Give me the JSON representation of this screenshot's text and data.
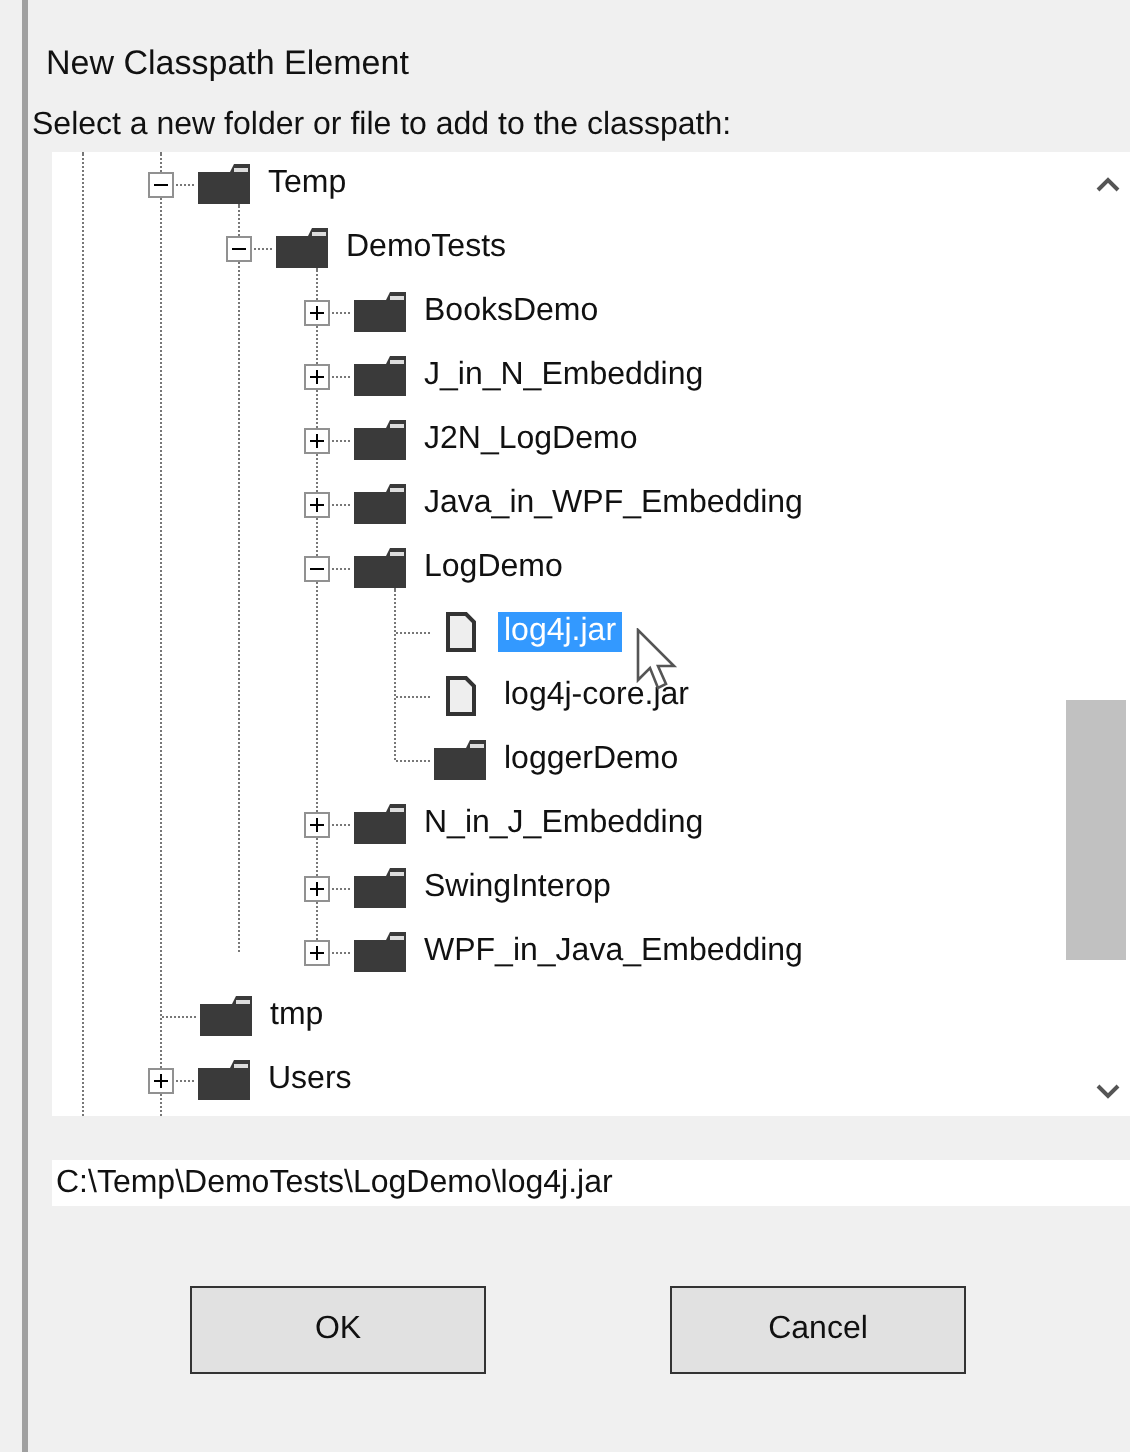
{
  "window": {
    "title": "New Classpath Element"
  },
  "prompt": "Select a new folder or file to add to the classpath:",
  "tree": [
    {
      "label": "Temp",
      "kind": "folder",
      "expanded": true,
      "selected": false,
      "children": [
        {
          "label": "DemoTests",
          "kind": "folder",
          "expanded": true,
          "selected": false,
          "children": [
            {
              "label": "BooksDemo",
              "kind": "folder",
              "expanded": false,
              "selected": false
            },
            {
              "label": "J_in_N_Embedding",
              "kind": "folder",
              "expanded": false,
              "selected": false
            },
            {
              "label": "J2N_LogDemo",
              "kind": "folder",
              "expanded": false,
              "selected": false
            },
            {
              "label": "Java_in_WPF_Embedding",
              "kind": "folder",
              "expanded": false,
              "selected": false
            },
            {
              "label": "LogDemo",
              "kind": "folder",
              "expanded": true,
              "selected": false,
              "children": [
                {
                  "label": "log4j.jar",
                  "kind": "file",
                  "selected": true
                },
                {
                  "label": "log4j-core.jar",
                  "kind": "file",
                  "selected": false
                },
                {
                  "label": "loggerDemo",
                  "kind": "folder",
                  "selected": false
                }
              ]
            },
            {
              "label": "N_in_J_Embedding",
              "kind": "folder",
              "expanded": false,
              "selected": false
            },
            {
              "label": "SwingInterop",
              "kind": "folder",
              "expanded": false,
              "selected": false
            },
            {
              "label": "WPF_in_Java_Embedding",
              "kind": "folder",
              "expanded": false,
              "selected": false
            }
          ]
        }
      ]
    },
    {
      "label": "tmp",
      "kind": "folder",
      "selected": false
    },
    {
      "label": "Users",
      "kind": "folder",
      "expanded": false,
      "selected": false
    }
  ],
  "path": "C:\\Temp\\DemoTests\\LogDemo\\log4j.jar",
  "buttons": [
    "OK",
    "Cancel"
  ]
}
